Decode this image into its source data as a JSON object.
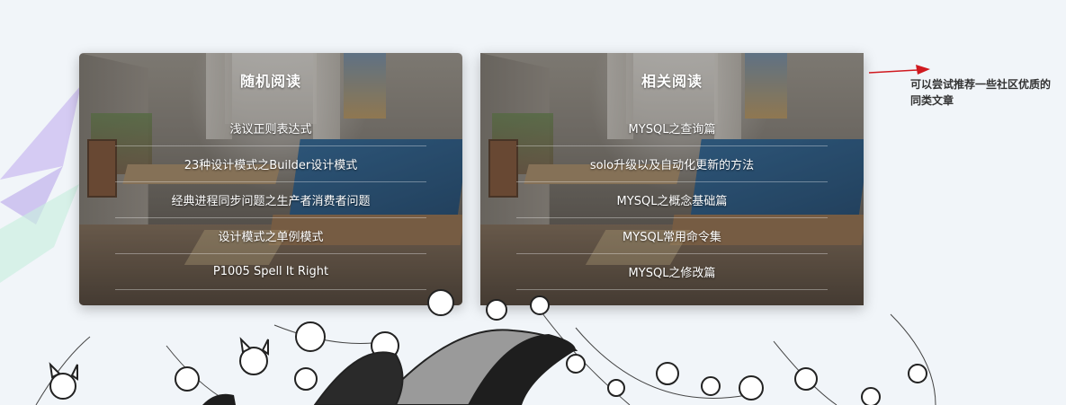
{
  "random_reading": {
    "title": "随机阅读",
    "items": [
      "浅议正则表达式",
      "23种设计模式之Builder设计模式",
      "经典进程同步问题之生产者消费者问题",
      "设计模式之单例模式",
      "P1005 Spell It Right"
    ]
  },
  "related_reading": {
    "title": "相关阅读",
    "items": [
      "MYSQL之查询篇",
      "solo升级以及自动化更新的方法",
      "MYSQL之概念基础篇",
      "MYSQL常用命令集",
      "MYSQL之修改篇"
    ]
  },
  "annotation": {
    "text": "可以尝试推荐一些社区优质的同类文章",
    "arrow_color": "#d0191f"
  },
  "colors": {
    "page_bg": "#f1f5f9",
    "link_text": "#ffffff"
  }
}
